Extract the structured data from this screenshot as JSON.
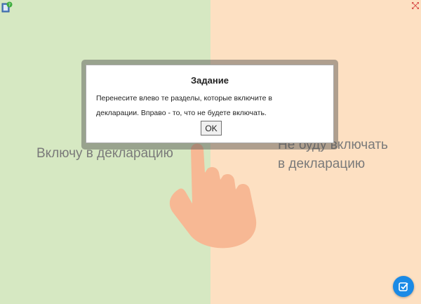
{
  "left_zone": {
    "label": "Включу в декларацию"
  },
  "right_zone": {
    "label": "Не буду включать в декларацию"
  },
  "dialog": {
    "title": "Задание",
    "message_line1": "Перенесите влево те разделы, которые включите в",
    "message_line2": "декларации. Вправо - то, что не будете включать.",
    "ok_label": "OK"
  },
  "icons": {
    "help": "help-book-icon",
    "fullscreen": "fullscreen-icon",
    "submit": "check-submit-icon",
    "hand": "hand-pointer-icon"
  },
  "colors": {
    "left_zone": "#d6e8c2",
    "right_zone": "#fde0c2",
    "hand": "#f7b894",
    "submit_button": "#1a8ae6"
  }
}
